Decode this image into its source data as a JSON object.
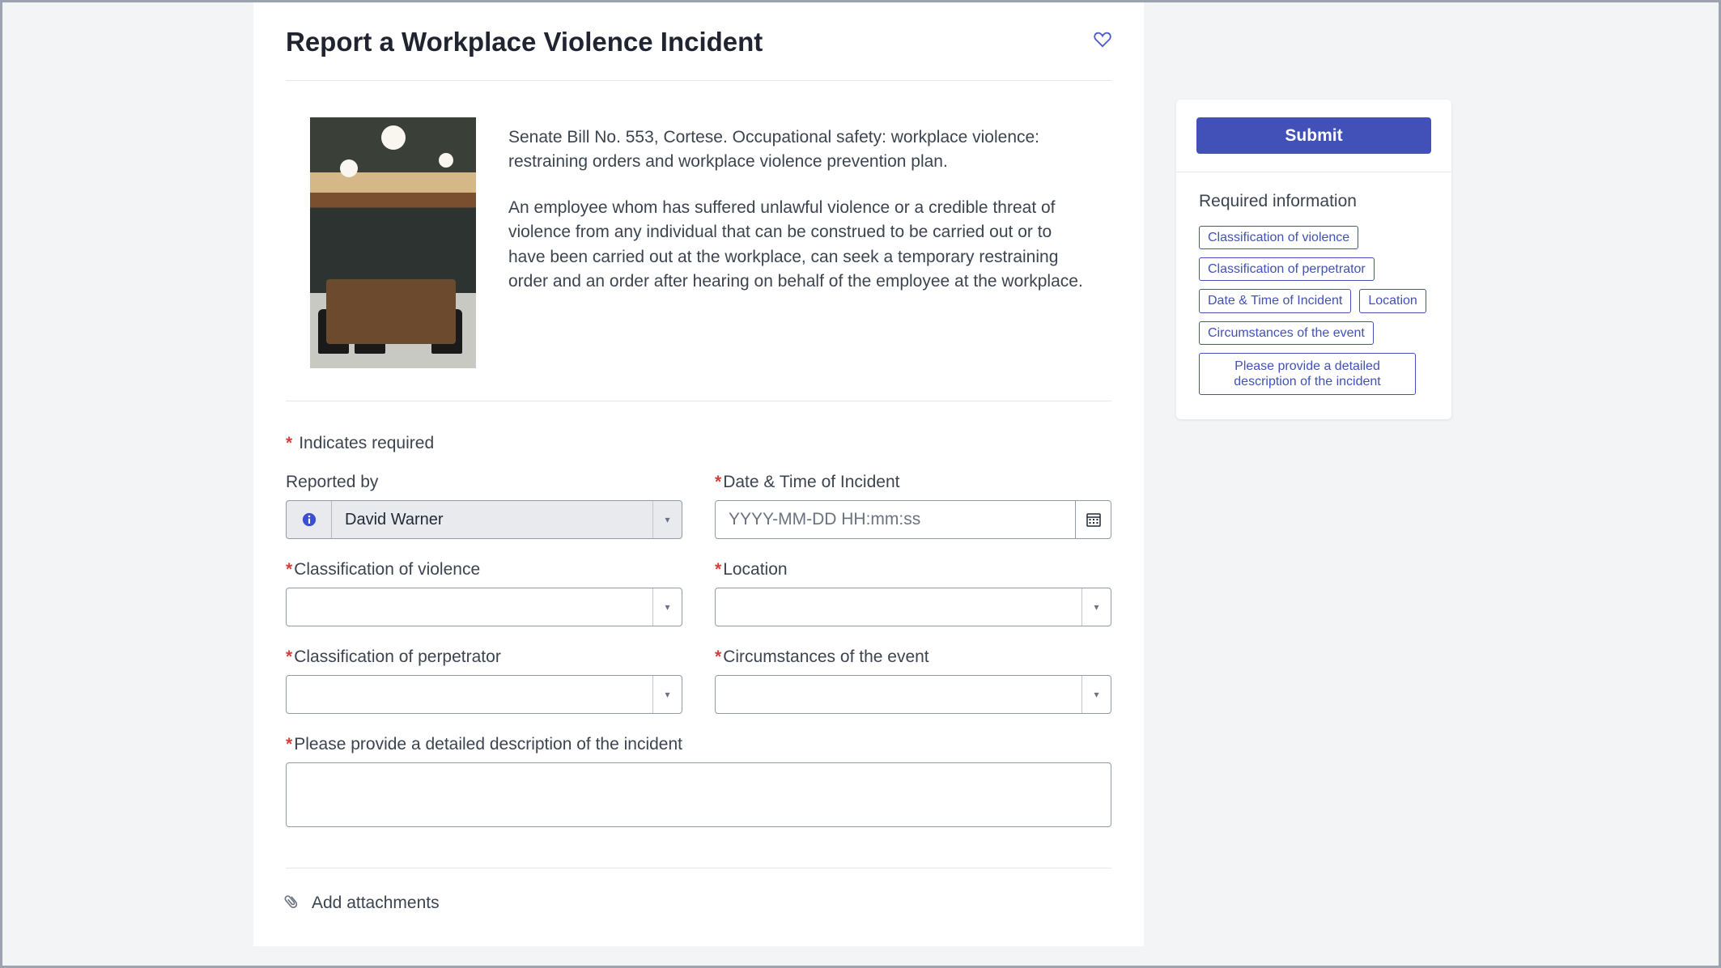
{
  "header": {
    "title": "Report a Workplace Violence Incident"
  },
  "intro": {
    "p1": "Senate Bill No. 553, Cortese. Occupational safety: workplace violence: restraining orders and workplace violence prevention plan.",
    "p2": "An employee whom has suffered unlawful violence or a credible threat of violence from any individual that can be construed to be carried out or to have been carried out at the workplace, can seek a temporary restraining order and an order after hearing on behalf of the employee at the workplace."
  },
  "form": {
    "required_note": "Indicates required",
    "reported_by_label": "Reported by",
    "reported_by_value": "David Warner",
    "datetime_label": "Date & Time of Incident",
    "datetime_placeholder": "YYYY-MM-DD HH:mm:ss",
    "class_violence_label": "Classification of violence",
    "location_label": "Location",
    "class_perp_label": "Classification of perpetrator",
    "circumstances_label": "Circumstances of the event",
    "description_label": "Please provide a detailed description of the incident",
    "attachments_label": "Add attachments"
  },
  "sidebar": {
    "submit_label": "Submit",
    "required_heading": "Required information",
    "chips": [
      "Classification of violence",
      "Classification of perpetrator",
      "Date & Time of Incident",
      "Location",
      "Circumstances of the event",
      "Please provide a detailed description of the incident"
    ]
  }
}
